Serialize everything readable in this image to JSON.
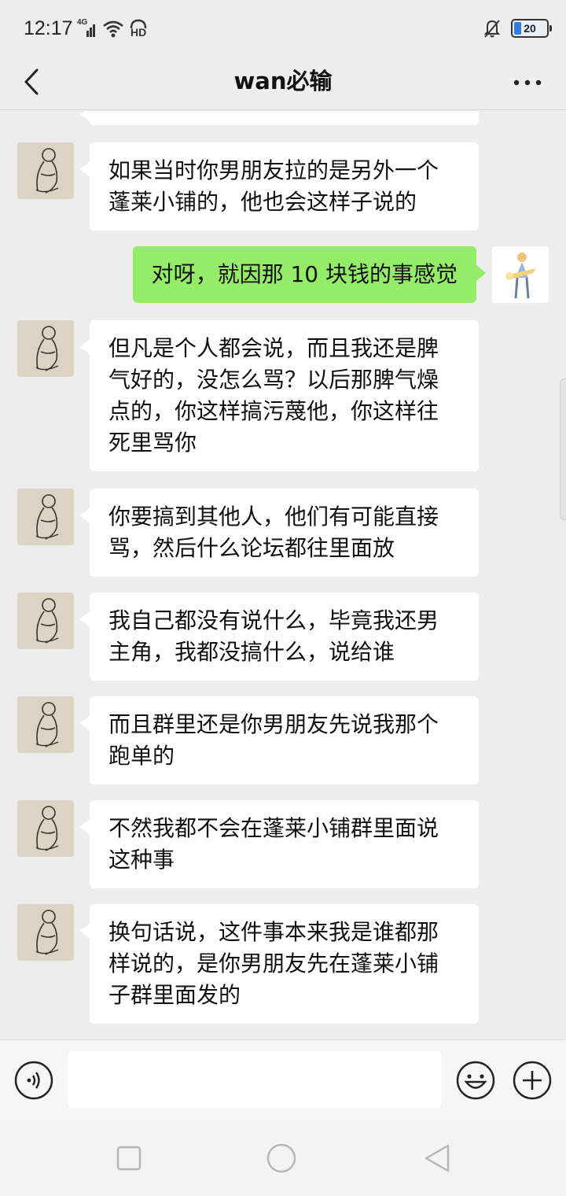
{
  "status_bar": {
    "time": "12:17",
    "network": "4G",
    "hd": "HD",
    "battery_level": "20"
  },
  "header": {
    "title": "wan必输"
  },
  "messages": [
    {
      "side": "left",
      "text": "如果当时你男朋友拉的是另外一个蓬莱小铺的，他也会这样子说的"
    },
    {
      "side": "right",
      "text": "对呀，就因那 10 块钱的事感觉"
    },
    {
      "side": "left",
      "text": "但凡是个人都会说，而且我还是脾气好的，没怎么骂？以后那脾气燥点的，你这样搞污蔑他，你这样往死里骂你"
    },
    {
      "side": "left",
      "text": "你要搞到其他人，他们有可能直接骂，然后什么论坛都往里面放"
    },
    {
      "side": "left",
      "text": "我自己都没有说什么，毕竟我还男主角，我都没搞什么，说给谁"
    },
    {
      "side": "left",
      "text": "而且群里还是你男朋友先说我那个跑单的"
    },
    {
      "side": "left",
      "text": "不然我都不会在蓬莱小铺群里面说这种事"
    },
    {
      "side": "left",
      "text": "换句话说，这件事本来我是谁都那样说的，是你男朋友先在蓬莱小铺子群里面发的"
    }
  ],
  "input": {
    "value": ""
  },
  "colors": {
    "sent_bubble": "#95ec69",
    "received_bubble": "#ffffff",
    "background": "#ededed"
  }
}
